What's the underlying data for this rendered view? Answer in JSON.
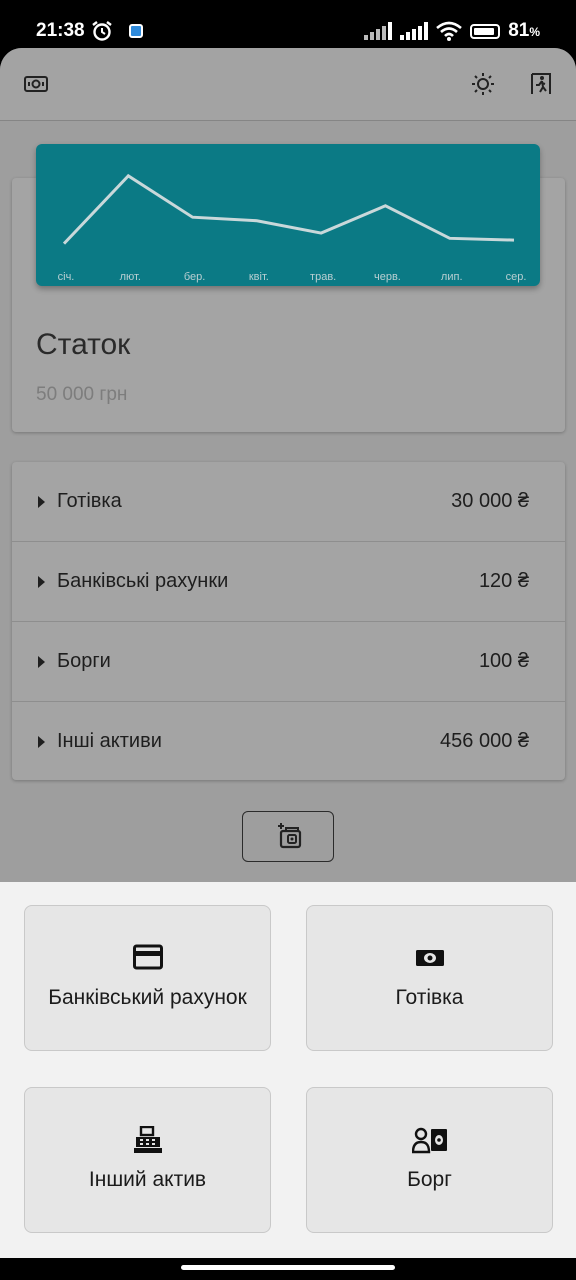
{
  "status_bar": {
    "time": "21:38",
    "battery_percent": "81",
    "battery_suffix": "%"
  },
  "icons": {
    "status": [
      "alarm-icon",
      "app-notification-icon",
      "signal-icon",
      "signal-icon",
      "wifi-icon",
      "battery-icon"
    ],
    "appbar": [
      "money-icon",
      "brightness-icon",
      "exit-icon"
    ],
    "add_button": "add-wallet-icon",
    "tiles": [
      "credit-card-icon",
      "cash-icon",
      "cash-register-icon",
      "debt-icon"
    ]
  },
  "chart_data": {
    "type": "line",
    "categories": [
      "січ.",
      "лют.",
      "бер.",
      "квіт.",
      "трав.",
      "черв.",
      "лип.",
      "сер."
    ],
    "values": [
      5,
      82,
      35,
      31,
      17,
      48,
      11,
      9
    ],
    "ylim": [
      0,
      100
    ],
    "grid": false,
    "line_color": "#c9d8da",
    "background": "#0b7a85"
  },
  "balance": {
    "title": "Статок",
    "value": "50 000 грн"
  },
  "accounts": [
    {
      "label": "Готівка",
      "amount": "30 000 ₴"
    },
    {
      "label": "Банківські рахунки",
      "amount": "120 ₴"
    },
    {
      "label": "Борги",
      "amount": "100 ₴"
    },
    {
      "label": "Інші активи",
      "amount": "456 000 ₴"
    }
  ],
  "sheet": {
    "options": [
      {
        "label": "Банківський рахунок"
      },
      {
        "label": "Готівка"
      },
      {
        "label": "Інший актив"
      },
      {
        "label": "Борг"
      }
    ]
  },
  "colors": {
    "accent": "#0b7a85",
    "sheet_background": "#f2f2f2",
    "scrim_background": "#9e9e9e"
  }
}
